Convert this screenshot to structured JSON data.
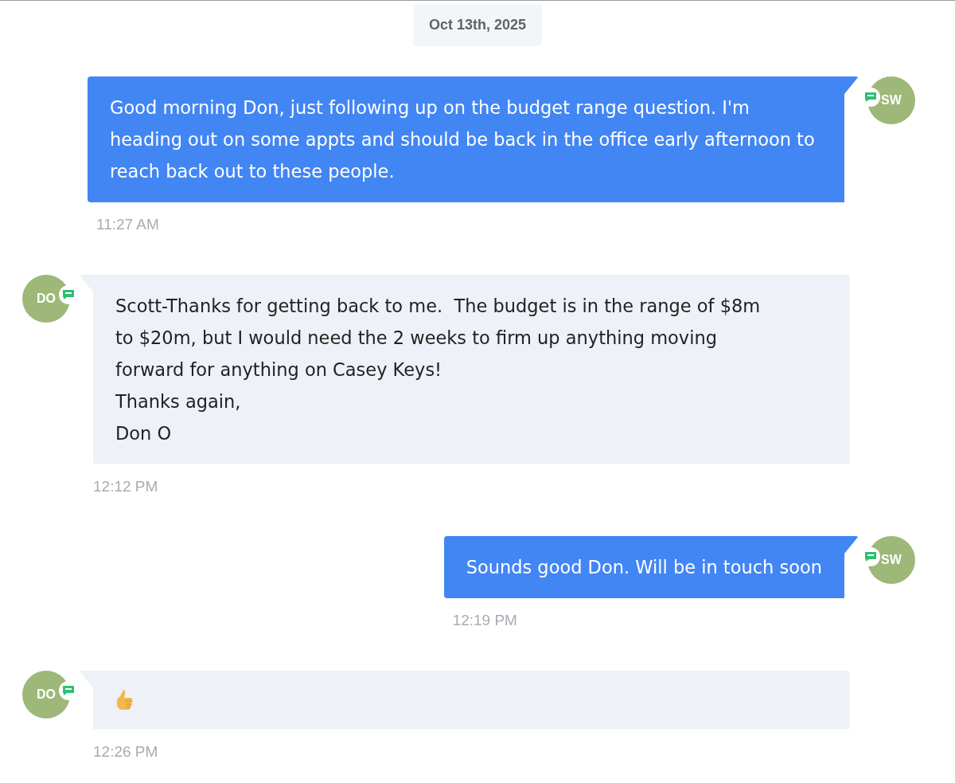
{
  "date_label": "Oct 13th, 2025",
  "messages": [
    {
      "sent": true,
      "avatar": "SW",
      "kind": "text",
      "text": "Good morning Don, just following up on the budget range question. I'm heading out on some appts and should be back in the office early afternoon to reach back out to these people.",
      "time": "11:27 AM"
    },
    {
      "sent": false,
      "avatar": "DO",
      "kind": "text",
      "text": "Scott-Thanks for getting back to me.  The budget is in the range of $8m\nto $20m, but I would need the 2 weeks to firm up anything moving\nforward for anything on Casey Keys!\nThanks again,\nDon O",
      "time": "12:12 PM"
    },
    {
      "sent": true,
      "avatar": "SW",
      "kind": "text",
      "text": "Sounds good Don. Will be in touch soon",
      "time": "12:19 PM"
    },
    {
      "sent": false,
      "avatar": "DO",
      "kind": "thumbs_up",
      "time": "12:26 PM"
    }
  ]
}
